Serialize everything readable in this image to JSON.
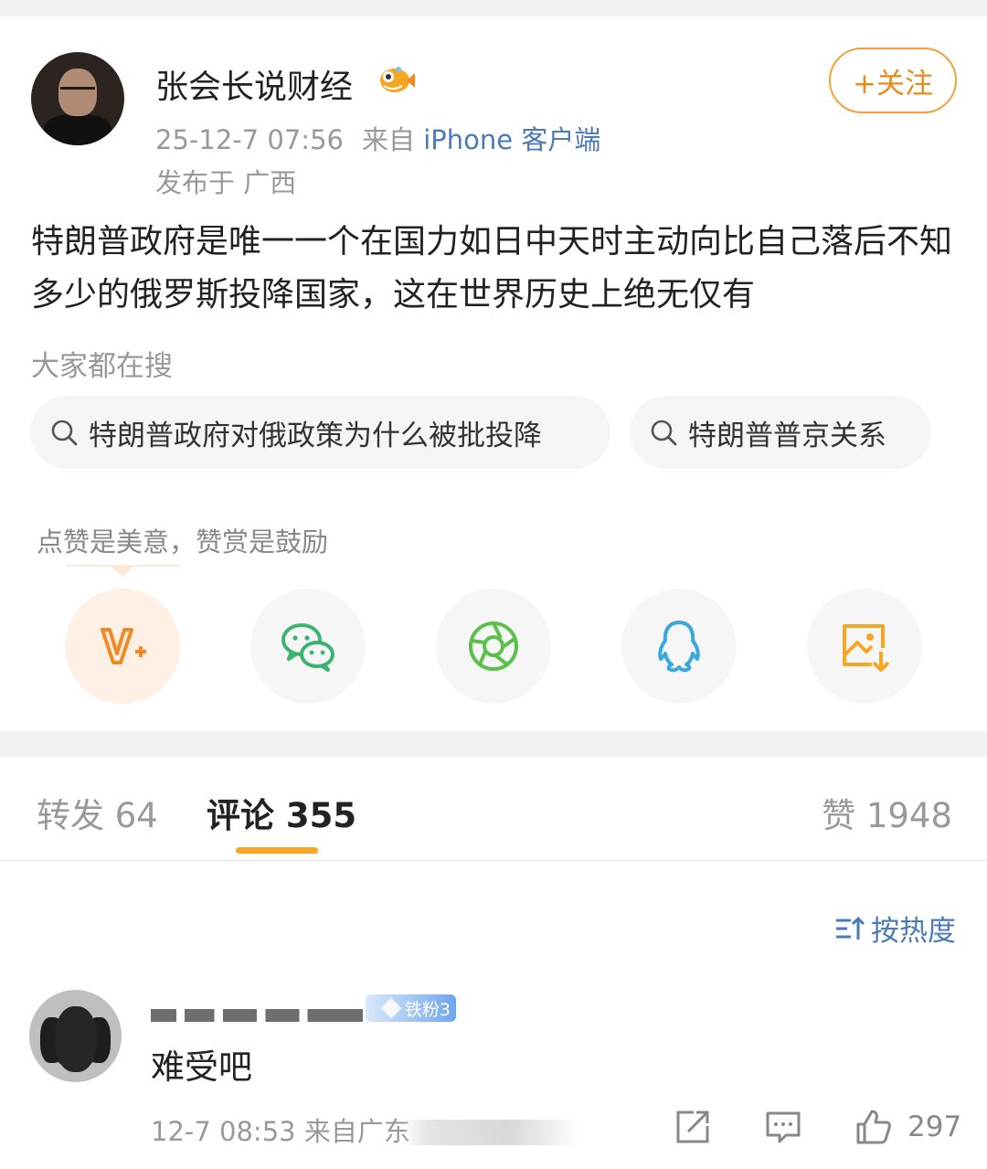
{
  "post": {
    "author": "张会长说财经",
    "timestamp": "25-12-7 07:56",
    "from_label": "来自",
    "source": "iPhone 客户端",
    "location": "发布于 广西",
    "follow_label": "+关注",
    "text": "特朗普政府是唯一一个在国力如日中天时主动向比自己落后不知多少的俄罗斯投降国家，这在世界历史上绝无仅有"
  },
  "search": {
    "label": "大家都在搜",
    "chips": [
      "特朗普政府对俄政策为什么被批投降",
      "特朗普普京关系"
    ]
  },
  "reward": {
    "tip": "点赞是美意，赞赏是鼓励",
    "icons": [
      "v-plus-icon",
      "wechat-icon",
      "moments-icon",
      "qq-icon",
      "save-image-icon"
    ]
  },
  "tabs": {
    "repost": "转发 64",
    "comment": "评论 355",
    "like": "赞 1948"
  },
  "sort": {
    "label": "按热度"
  },
  "comment": {
    "badge": "铁粉3",
    "text": "难受吧",
    "meta": "12-7 08:53 来自广东",
    "like_count": "297"
  },
  "colors": {
    "accent_orange": "#f5a623",
    "link_blue": "#4a7ab8",
    "follow_orange": "#e98b1c"
  }
}
